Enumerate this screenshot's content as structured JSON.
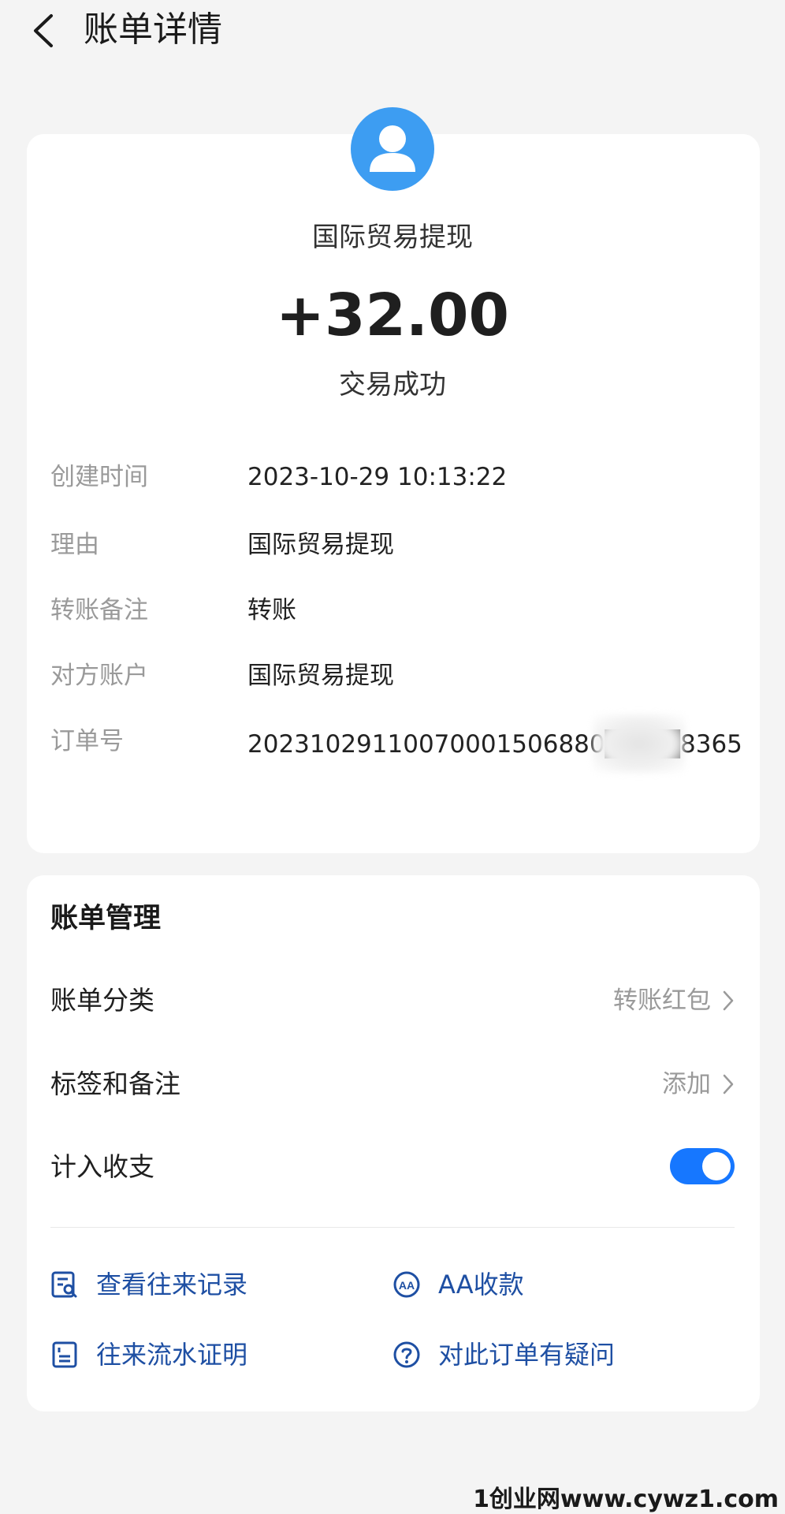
{
  "header": {
    "title": "账单详情"
  },
  "payee": {
    "name": "国际贸易提现"
  },
  "transaction": {
    "amount": "+32.00",
    "status": "交易成功"
  },
  "details": [
    {
      "label": "创建时间",
      "value": "2023-10-29 10:13:22"
    },
    {
      "label": "理由",
      "value": "国际贸易提现"
    },
    {
      "label": "转账备注",
      "value": "转账"
    },
    {
      "label": "对方账户",
      "value": "国际贸易提现"
    },
    {
      "label": "订单号",
      "value": "20231029110070001506880████8365"
    }
  ],
  "management": {
    "title": "账单管理",
    "category_label": "账单分类",
    "category_value": "转账红包",
    "tags_label": "标签和备注",
    "tags_value": "添加",
    "include_label": "计入收支",
    "include_on": true
  },
  "actions": {
    "view_records": "查看往来记录",
    "aa_collect": "AA收款",
    "flow_proof": "往来流水证明",
    "order_question": "对此订单有疑问"
  },
  "watermark": "1创业网www.cywz1.com",
  "colors": {
    "accent": "#1677ff",
    "link": "#1e4fa3",
    "avatar": "#3d9df2"
  }
}
